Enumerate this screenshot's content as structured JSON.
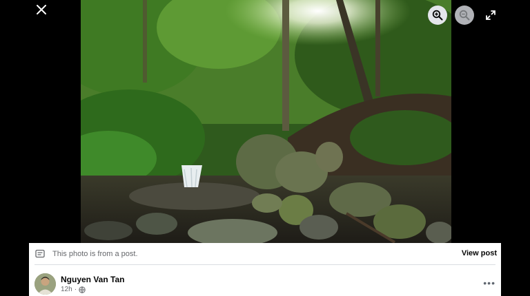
{
  "viewer": {
    "close_icon": "close-icon",
    "zoom_in_icon": "zoom-in-icon",
    "zoom_out_icon": "zoom-out-icon",
    "fullscreen_icon": "fullscreen-icon"
  },
  "post_info": {
    "notice_icon": "post-icon",
    "notice_text": "This photo is from a post.",
    "view_post_label": "View post",
    "author_name": "Nguyen Van Tan",
    "timestamp": "12h",
    "separator": "·",
    "privacy_icon": "globe-icon",
    "more_icon": "more-options-icon",
    "more_label": "•••"
  }
}
